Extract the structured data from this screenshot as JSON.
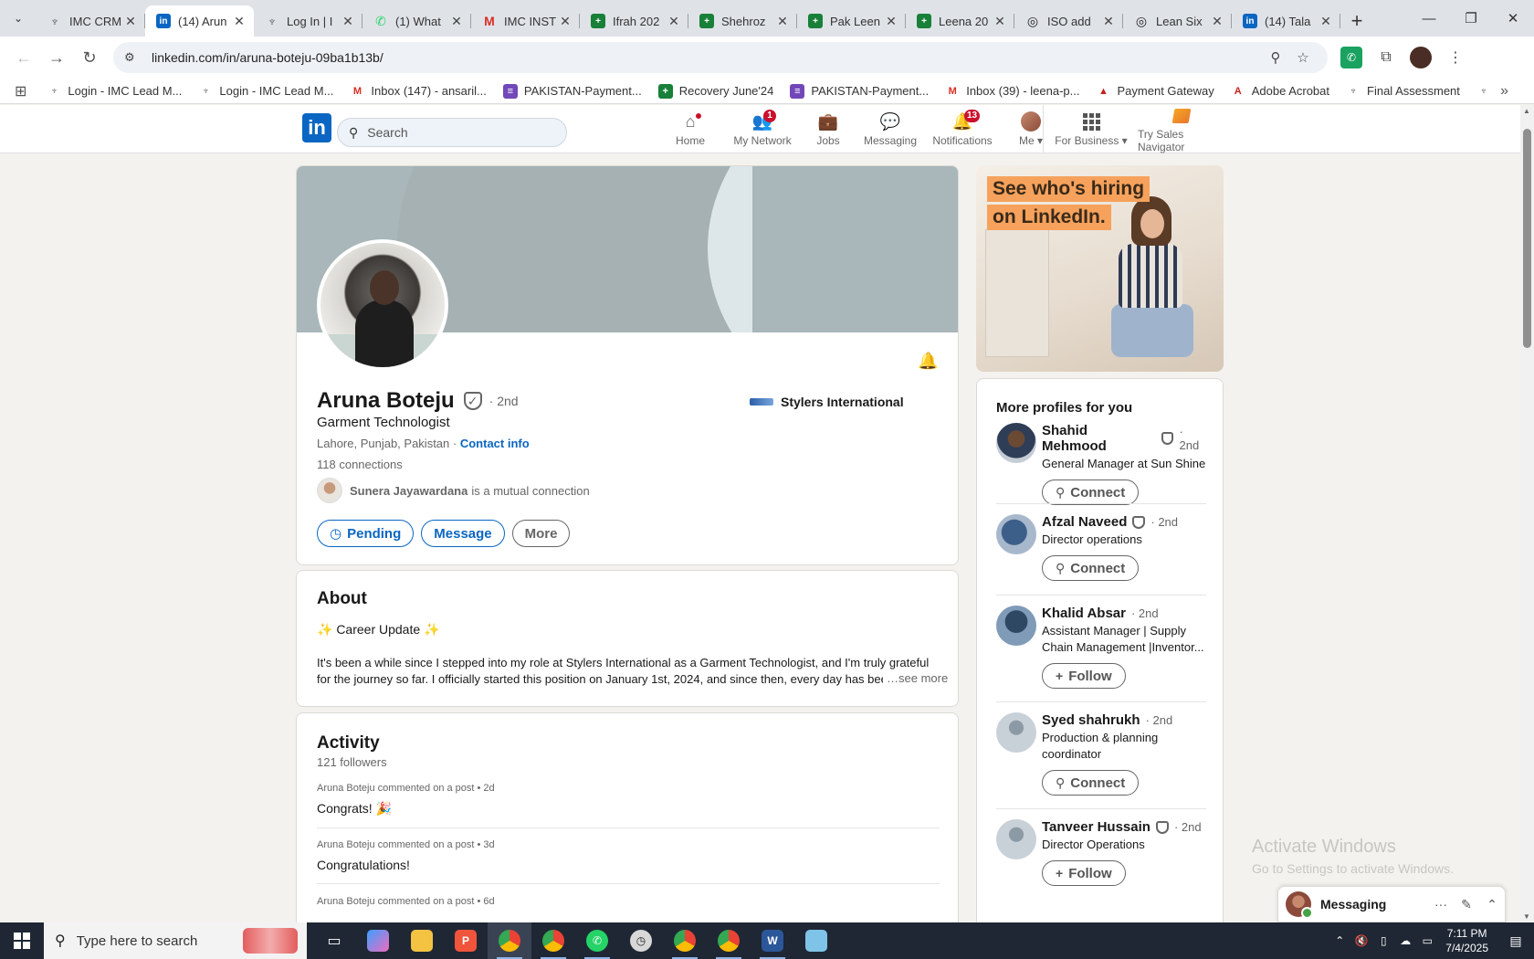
{
  "browser": {
    "tabs": [
      {
        "title": "IMC CRM",
        "fav_color": "#555555",
        "fav_glyph": "♆"
      },
      {
        "title": "(14) Arun",
        "fav_color": "#0a66c2",
        "fav_glyph": "in",
        "active": true
      },
      {
        "title": "Log In | I",
        "fav_color": "#555555",
        "fav_glyph": "♆"
      },
      {
        "title": "(1) What",
        "fav_color": "#25d366",
        "fav_glyph": "✆"
      },
      {
        "title": "IMC INST",
        "fav_color": "#d93025",
        "fav_glyph": "M"
      },
      {
        "title": "Ifrah 202",
        "fav_color": "#188038",
        "fav_glyph": "+"
      },
      {
        "title": "Shehroz",
        "fav_color": "#188038",
        "fav_glyph": "+"
      },
      {
        "title": "Pak Leen",
        "fav_color": "#188038",
        "fav_glyph": "+"
      },
      {
        "title": "Leena 20",
        "fav_color": "#188038",
        "fav_glyph": "+"
      },
      {
        "title": "ISO add",
        "fav_color": "#222222",
        "fav_glyph": "◎"
      },
      {
        "title": "Lean Six",
        "fav_color": "#222222",
        "fav_glyph": "◎"
      },
      {
        "title": "(14) Tala",
        "fav_color": "#0a66c2",
        "fav_glyph": "in"
      }
    ],
    "url": "linkedin.com/in/aruna-boteju-09ba1b13b/",
    "bookmarks": [
      {
        "label": "Login - IMC Lead M...",
        "color": "#555555",
        "glyph": "♆"
      },
      {
        "label": "Login - IMC Lead M...",
        "color": "#555555",
        "glyph": "♆"
      },
      {
        "label": "Inbox (147) - ansaril...",
        "color": "#d93025",
        "glyph": "M"
      },
      {
        "label": "PAKISTAN-Payment...",
        "color": "#7248b9",
        "glyph": "≡"
      },
      {
        "label": "Recovery June'24",
        "color": "#188038",
        "glyph": "+"
      },
      {
        "label": "PAKISTAN-Payment...",
        "color": "#7248b9",
        "glyph": "≡"
      },
      {
        "label": "Inbox (39) - leena-p...",
        "color": "#d93025",
        "glyph": "M"
      },
      {
        "label": "Payment Gateway",
        "color": "#c5221f",
        "glyph": "▲"
      },
      {
        "label": "Adobe Acrobat",
        "color": "#c5221f",
        "glyph": "A"
      },
      {
        "label": "Final Assessment",
        "color": "#555555",
        "glyph": "♆"
      }
    ]
  },
  "linkedin": {
    "search_placeholder": "Search",
    "nav": {
      "home": "Home",
      "network": "My Network",
      "network_badge": "1",
      "jobs": "Jobs",
      "messaging": "Messaging",
      "notifications": "Notifications",
      "notifications_badge": "13",
      "me": "Me",
      "business": "For Business",
      "sales": "Try Sales Navigator"
    },
    "profile": {
      "name": "Aruna Boteju",
      "degree": "· 2nd",
      "headline": "Garment Technologist",
      "location": "Lahore, Punjab, Pakistan",
      "location_sep": " · ",
      "contact": "Contact info",
      "connections": "118 connections",
      "mutual_name": "Sunera Jayawardana",
      "mutual_suffix": "is a mutual connection",
      "company": "Stylers International",
      "btn_pending": "Pending",
      "btn_message": "Message",
      "btn_more": "More"
    },
    "about": {
      "title": "About",
      "update": "✨ Career Update ✨",
      "text": "It's been a while since I stepped into my role at Stylers International as a Garment Technologist, and I'm truly grateful for the journey so far. I officially started this position on January 1st, 2024, and since then, every day has been a ne",
      "see_more": "…see more"
    },
    "activity": {
      "title": "Activity",
      "followers": "121 followers",
      "items": [
        {
          "author": "Aruna Boteju",
          "meta": "commented on a post • 2d",
          "text": "Congrats! 🎉"
        },
        {
          "author": "Aruna Boteju",
          "meta": "commented on a post • 3d",
          "text": "Congratulations!"
        },
        {
          "author": "Aruna Boteju",
          "meta": "commented on a post • 6d",
          "text": ""
        }
      ]
    },
    "ad": {
      "line1": "See who's hiring",
      "line2": "on LinkedIn."
    },
    "more_profiles": {
      "title": "More profiles for you",
      "items": [
        {
          "name": "Shahid Mehmood",
          "verified": true,
          "degree": "· 2nd",
          "headline": "General Manager at Sun Shine",
          "action": "Connect"
        },
        {
          "name": "Afzal Naveed",
          "verified": true,
          "degree": "· 2nd",
          "headline": "Director operations",
          "action": "Connect"
        },
        {
          "name": "Khalid Absar",
          "verified": false,
          "degree": "· 2nd",
          "headline": "Assistant Manager | Supply Chain Management |Inventor...",
          "action": "Follow"
        },
        {
          "name": "Syed shahrukh",
          "verified": false,
          "degree": "· 2nd",
          "headline": "Production & planning coordinator",
          "action": "Connect"
        },
        {
          "name": "Tanveer Hussain",
          "verified": true,
          "degree": "· 2nd",
          "headline": "Director Operations",
          "action": "Follow"
        }
      ]
    },
    "messaging_label": "Messaging"
  },
  "watermark": {
    "line1": "Activate Windows",
    "line2": "Go to Settings to activate Windows."
  },
  "taskbar": {
    "search_placeholder": "Type here to search",
    "time": "7:11 PM",
    "date": "7/4/2025"
  }
}
